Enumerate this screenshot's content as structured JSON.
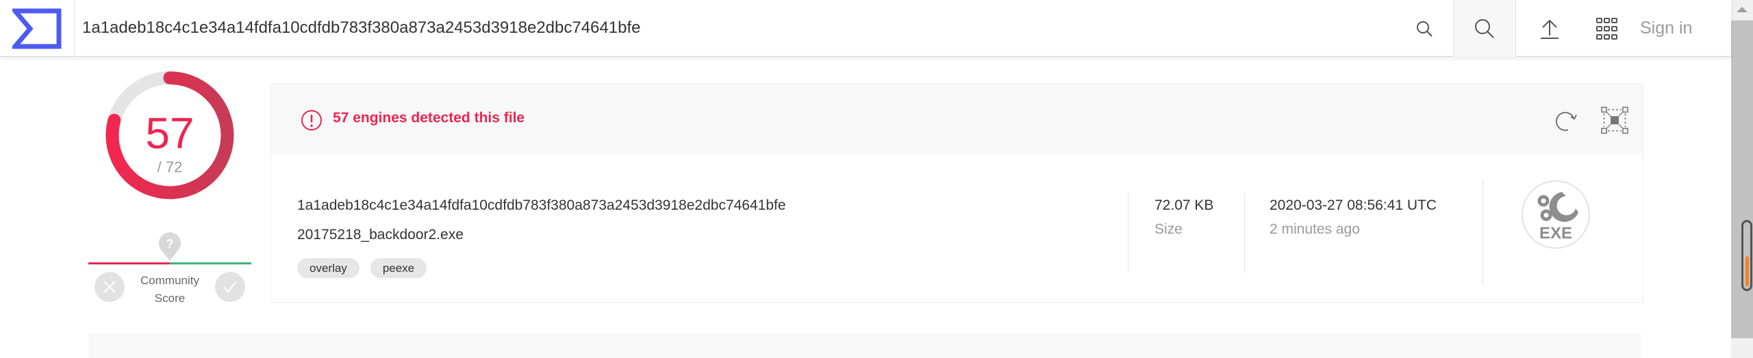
{
  "header": {
    "search_value": "1a1adeb18c4c1e34a14fdfa10cdfdb783f380a873a2453d3918e2dbc74641bfe",
    "sign_in": "Sign in",
    "icons": [
      "logo-sigma",
      "search-icon",
      "search-icon",
      "upload-icon",
      "apps-grid-icon"
    ],
    "brand_color": "#4d5bf2"
  },
  "score": {
    "detected": "57",
    "total": "/ 72",
    "fraction": 0.7917,
    "color": "#ee2450"
  },
  "community": {
    "label_line1": "Community",
    "label_line2": "Score",
    "value_icon": "question-icon"
  },
  "summary": {
    "detection_text": "57 engines detected this file",
    "hash": "1a1adeb18c4c1e34a14fdfa10cdfdb783f380a873a2453d3918e2dbc74641bfe",
    "filename": "20175218_backdoor2.exe",
    "tags": [
      "overlay",
      "peexe"
    ],
    "size_value": "72.07 KB",
    "size_label": "Size",
    "date_value": "2020-03-27 08:56:41 UTC",
    "date_relative": "2 minutes ago",
    "file_type": "EXE"
  },
  "scrollbar": {
    "accent": "#f58220"
  }
}
